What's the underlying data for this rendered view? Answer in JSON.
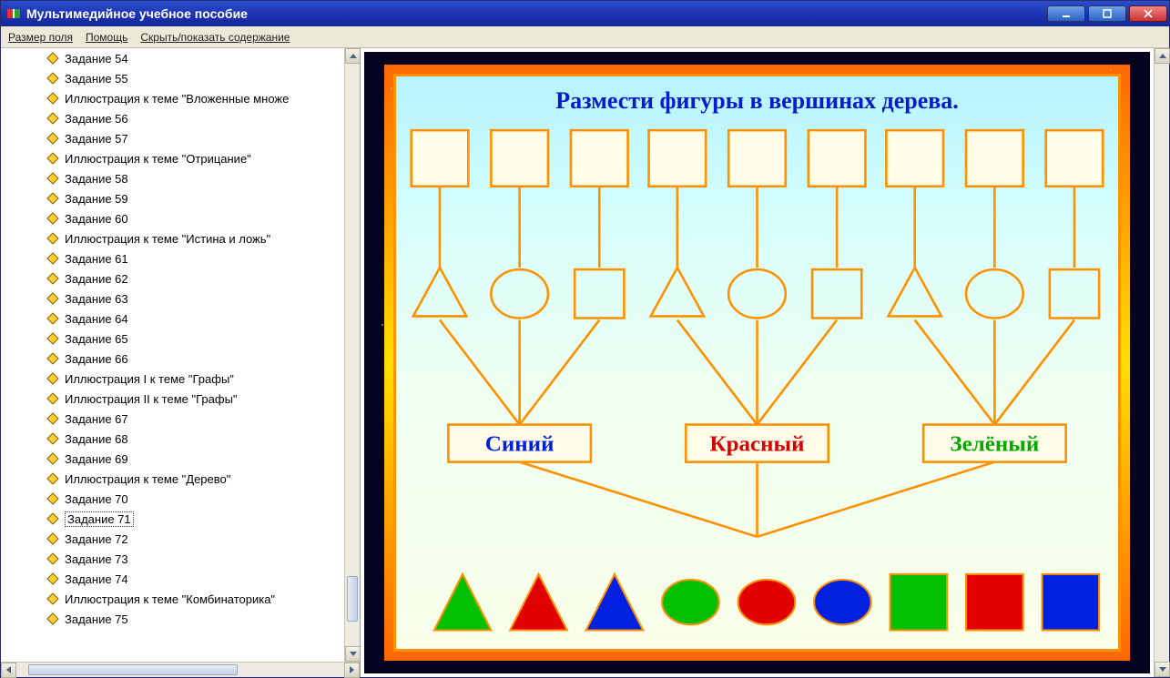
{
  "window": {
    "title": "Мультимедийное учебное пособие"
  },
  "menu": {
    "field_size": "Размер поля",
    "help": "Помощь",
    "toggle_toc": "Скрыть/показать содержание"
  },
  "sidebar": {
    "selected_index": 23,
    "items": [
      "Задание 54",
      "Задание 55",
      "Иллюстрация к теме \"Вложенные множе",
      "Задание 56",
      "Задание 57",
      "Иллюстрация к теме \"Отрицание\"",
      "Задание 58",
      "Задание 59",
      "Задание 60",
      "Иллюстрация к теме \"Истина и ложь\"",
      "Задание 61",
      "Задание 62",
      "Задание 63",
      "Задание 64",
      "Задание 65",
      "Задание 66",
      "Иллюстрация I к теме \"Графы\"",
      "Иллюстрация II к теме \"Графы\"",
      "Задание 67",
      "Задание 68",
      "Задание 69",
      "Иллюстрация к теме \"Дерево\"",
      "Задание 70",
      "Задание 71",
      "Задание 72",
      "Задание 73",
      "Задание 74",
      "Иллюстрация к теме \"Комбинаторика\"",
      "Задание 75"
    ]
  },
  "task": {
    "title": "Размести фигуры в вершинах дерева.",
    "categories": [
      {
        "label": "Синий",
        "color": "#0020e0"
      },
      {
        "label": "Красный",
        "color": "#d80000"
      },
      {
        "label": "Зелёный",
        "color": "#00a800"
      }
    ],
    "palette": [
      {
        "shape": "triangle",
        "color": "#00c000"
      },
      {
        "shape": "triangle",
        "color": "#e00000"
      },
      {
        "shape": "triangle",
        "color": "#0020e0"
      },
      {
        "shape": "circle",
        "color": "#00c000"
      },
      {
        "shape": "circle",
        "color": "#e00000"
      },
      {
        "shape": "circle",
        "color": "#0020e0"
      },
      {
        "shape": "square",
        "color": "#00c000"
      },
      {
        "shape": "square",
        "color": "#e00000"
      },
      {
        "shape": "square",
        "color": "#0020e0"
      }
    ]
  }
}
